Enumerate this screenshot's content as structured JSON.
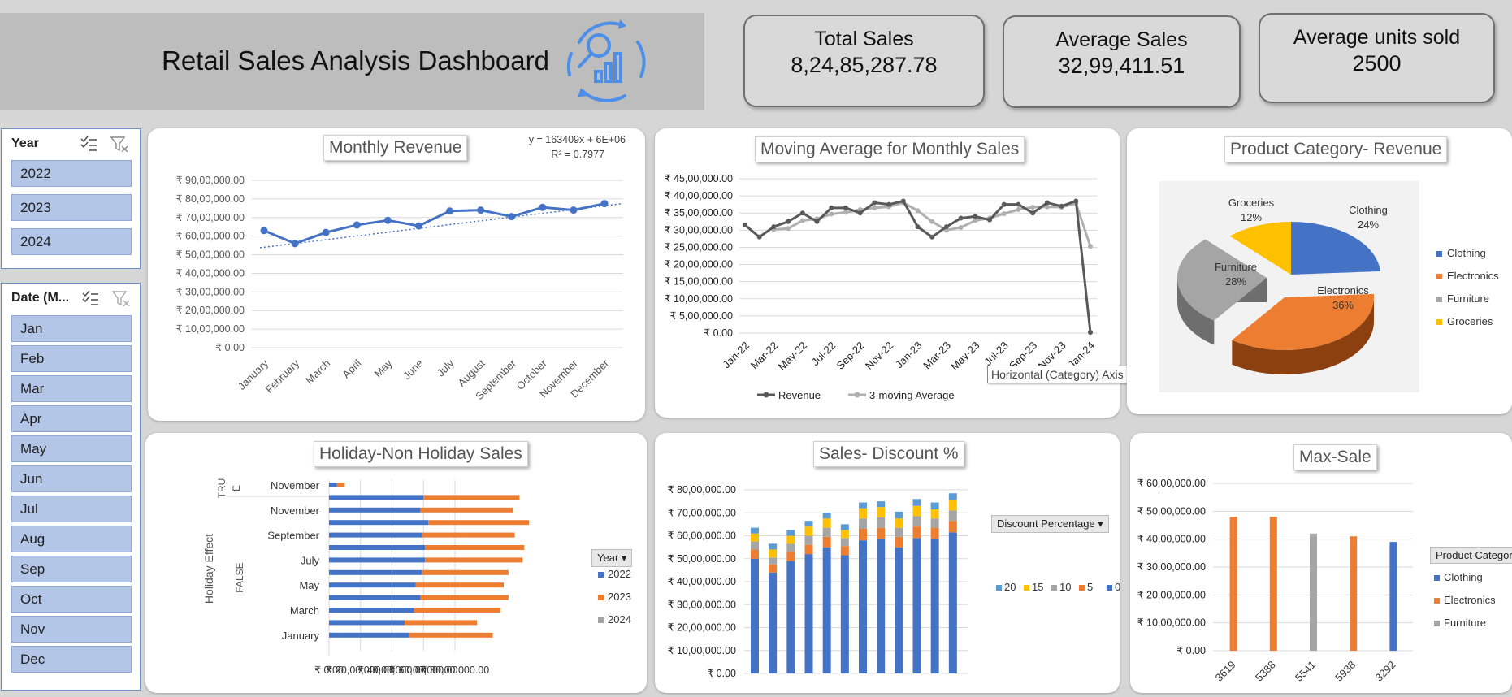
{
  "header": {
    "title": "Retail Sales Analysis Dashboard",
    "icon": "analytics-icon",
    "icon_color": "#4d8fe8"
  },
  "kpis": [
    {
      "label": "Total Sales",
      "value": "8,24,85,287.78"
    },
    {
      "label": "Average Sales",
      "value": "32,99,411.51"
    },
    {
      "label": "Average units sold",
      "value": "2500"
    }
  ],
  "year_slicer": {
    "title": "Year",
    "items": [
      "2022",
      "2023",
      "2024"
    ]
  },
  "month_slicer": {
    "title": "Date (M...",
    "items": [
      "Jan",
      "Feb",
      "Mar",
      "Apr",
      "May",
      "Jun",
      "Jul",
      "Aug",
      "Sep",
      "Oct",
      "Nov",
      "Dec"
    ]
  },
  "colors": {
    "blue": "#4472c4",
    "orange": "#ed7d31",
    "gray": "#a5a5a5",
    "yellow": "#ffc000",
    "navy": "#1f3864",
    "darkgray": "#595959",
    "lightgray": "#b0b0b0",
    "slicer_btn": "#b4c6e7"
  },
  "tooltip": "Horizontal (Category) Axis",
  "chart_data": [
    {
      "id": "monthly-revenue",
      "type": "line",
      "title": "Monthly Revenue",
      "categories": [
        "January",
        "February",
        "March",
        "April",
        "May",
        "June",
        "July",
        "August",
        "September",
        "October",
        "November",
        "December"
      ],
      "series": [
        {
          "values": [
            6300000,
            5600000,
            6200000,
            6600000,
            6850000,
            6550000,
            7350000,
            7400000,
            7050000,
            7550000,
            7400000,
            7750000
          ]
        }
      ],
      "trendline": {
        "equation": "y = 163409x + 6E+06",
        "r2": "R² = 0.7977"
      },
      "ylim": [
        0,
        9000000
      ],
      "yticks": [
        "₹ 0.00",
        "₹ 10,00,000.00",
        "₹ 20,00,000.00",
        "₹ 30,00,000.00",
        "₹ 40,00,000.00",
        "₹ 50,00,000.00",
        "₹ 60,00,000.00",
        "₹ 70,00,000.00",
        "₹ 80,00,000.00",
        "₹ 90,00,000.00"
      ],
      "grid": true
    },
    {
      "id": "moving-average",
      "type": "line",
      "title": "Moving Average for Monthly Sales",
      "categories": [
        "Jan-22",
        "Feb-22",
        "Mar-22",
        "Apr-22",
        "May-22",
        "Jun-22",
        "Jul-22",
        "Aug-22",
        "Sep-22",
        "Oct-22",
        "Nov-22",
        "Dec-22",
        "Jan-23",
        "Feb-23",
        "Mar-23",
        "Apr-23",
        "May-23",
        "Jun-23",
        "Jul-23",
        "Aug-23",
        "Sep-23",
        "Oct-23",
        "Nov-23",
        "Dec-23",
        "Jan-24"
      ],
      "xtick_labels": [
        "Jan-22",
        "Mar-22",
        "May-22",
        "Jul-22",
        "Sep-22",
        "Nov-22",
        "Jan-23",
        "Mar-23",
        "May-23",
        "Jul-23",
        "Sep-23",
        "Nov-23",
        "Jan-24"
      ],
      "series": [
        {
          "name": "Revenue",
          "values": [
            31500000,
            28000000,
            31000000,
            32500000,
            35000000,
            32500000,
            36500000,
            36500000,
            35000000,
            38000000,
            37500000,
            38500000,
            31000000,
            28000000,
            31000000,
            33500000,
            34000000,
            33000000,
            37500000,
            37500000,
            35000000,
            38000000,
            37000000,
            38500000,
            200000
          ]
        },
        {
          "name": "3-moving Average",
          "values": [
            null,
            null,
            30200000,
            30500000,
            32800000,
            33300000,
            34700000,
            35200000,
            36000000,
            36500000,
            36800000,
            38000000,
            35700000,
            32500000,
            30000000,
            30800000,
            32800000,
            33500000,
            34800000,
            36000000,
            36700000,
            36800000,
            36700000,
            37800000,
            25300000
          ]
        }
      ],
      "ylim": [
        0,
        45000000
      ],
      "yticks": [
        "₹ 0.00",
        "₹ 5,00,000.00",
        "₹ 10,00,000.00",
        "₹ 15,00,000.00",
        "₹ 20,00,000.00",
        "₹ 25,00,000.00",
        "₹ 30,00,000.00",
        "₹ 35,00,000.00",
        "₹ 40,00,000.00",
        "₹ 45,00,000.00"
      ],
      "legend": "bottom"
    },
    {
      "id": "category-revenue",
      "type": "pie",
      "title": "Product Category- Revenue",
      "slices": [
        {
          "name": "Clothing",
          "value": 24,
          "label": "24%"
        },
        {
          "name": "Electronics",
          "value": 36,
          "label": "36%"
        },
        {
          "name": "Furniture",
          "value": 28,
          "label": "28%"
        },
        {
          "name": "Groceries",
          "value": 12,
          "label": "12%"
        }
      ],
      "legend": "right"
    },
    {
      "id": "holiday-sales",
      "type": "bar",
      "orientation": "horizontal",
      "stacked": true,
      "title": "Holiday-Non Holiday Sales",
      "ylabel": "Holiday Effect",
      "groups": [
        {
          "label": "TRUE",
          "rows": 1
        },
        {
          "label": "FALSE",
          "rows": 12
        }
      ],
      "row_labels": [
        "November",
        "",
        "November",
        "",
        "September",
        "",
        "July",
        "",
        "May",
        "",
        "March",
        "",
        "January"
      ],
      "series": [
        {
          "name": "2022",
          "values": [
            500000,
            6000000,
            5800000,
            6300000,
            5900000,
            6100000,
            6100000,
            5900000,
            5500000,
            5800000,
            5400000,
            4800000,
            5100000
          ]
        },
        {
          "name": "2023",
          "values": [
            500000,
            6100000,
            5900000,
            6400000,
            5900000,
            6300000,
            6200000,
            5500000,
            5600000,
            5600000,
            5500000,
            4600000,
            5300000
          ]
        },
        {
          "name": "2024",
          "values": [
            0,
            0,
            0,
            0,
            0,
            0,
            0,
            0,
            0,
            0,
            0,
            0,
            0
          ]
        }
      ],
      "xticks": [
        "₹ 0.00",
        "₹ 20,00,000.00",
        "₹ 40,00,000.00",
        "₹ 60,00,000.00",
        "₹ 80,00,000.00"
      ],
      "xlim": [
        0,
        16000000
      ],
      "legend_title": "Year",
      "legend": "right"
    },
    {
      "id": "sales-discount",
      "type": "bar",
      "stacked": true,
      "title": "Sales- Discount %",
      "bar_count": 12,
      "series": [
        {
          "name": "0",
          "values": [
            50000000,
            44000000,
            49000000,
            52000000,
            55000000,
            51500000,
            58000000,
            58500000,
            55000000,
            59000000,
            58500000,
            61500000
          ]
        },
        {
          "name": "5",
          "values": [
            4000000,
            3500000,
            4000000,
            4000000,
            4500000,
            4000000,
            5000000,
            5000000,
            4500000,
            5000000,
            5000000,
            5000000
          ]
        },
        {
          "name": "10",
          "values": [
            3500000,
            3000000,
            3500000,
            4000000,
            4000000,
            3500000,
            4500000,
            4500000,
            4000000,
            4500000,
            4000000,
            4500000
          ]
        },
        {
          "name": "15",
          "values": [
            3500000,
            3500000,
            3500000,
            4000000,
            4000000,
            3500000,
            4500000,
            4500000,
            4000000,
            4500000,
            4000000,
            4500000
          ]
        },
        {
          "name": "20",
          "values": [
            2500000,
            2500000,
            2500000,
            2500000,
            2500000,
            2500000,
            2500000,
            2500000,
            3000000,
            3000000,
            3000000,
            3000000
          ]
        }
      ],
      "ylim": [
        0,
        80000000
      ],
      "yticks": [
        "₹ 0.00",
        "₹ 10,00,000.00",
        "₹ 20,00,000.00",
        "₹ 30,00,000.00",
        "₹ 40,00,000.00",
        "₹ 50,00,000.00",
        "₹ 60,00,000.00",
        "₹ 70,00,000.00",
        "₹ 80,00,000.00"
      ],
      "legend_title": "Discount  Percentage",
      "legend_order": [
        "20",
        "15",
        "10",
        "5",
        "0"
      ],
      "legend": "right"
    },
    {
      "id": "max-sale",
      "type": "bar",
      "title": "Max-Sale",
      "categories": [
        "3619",
        "5388",
        "5541",
        "5938",
        "3292"
      ],
      "values": [
        4800000,
        4800000,
        4200000,
        4100000,
        3900000
      ],
      "bar_series": [
        "Electronics",
        "Electronics",
        "Furniture",
        "Electronics",
        "Clothing"
      ],
      "ylim": [
        0,
        6000000
      ],
      "yticks": [
        "₹ 0.00",
        "₹ 10,00,000.00",
        "₹ 20,00,000.00",
        "₹ 30,00,000.00",
        "₹ 40,00,000.00",
        "₹ 50,00,000.00",
        "₹ 60,00,000.00"
      ],
      "legend_title": "Product Categor",
      "legend_items": [
        "Clothing",
        "Electronics",
        "Furniture"
      ],
      "legend": "right"
    }
  ]
}
